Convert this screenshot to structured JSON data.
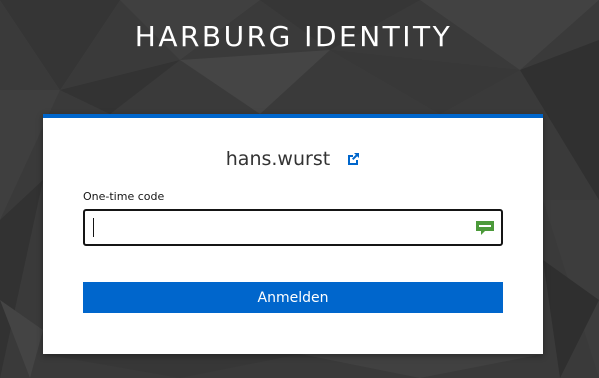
{
  "header": {
    "realm_title": "HARBURG IDENTITY"
  },
  "login": {
    "username": "hans.wurst",
    "switch_user_icon": "external-link-icon",
    "otp_label": "One-time code",
    "otp_value": "",
    "otp_icon": "sms-message-icon",
    "submit_label": "Anmelden"
  },
  "colors": {
    "accent": "#0066cc",
    "background": "#3b3b3b",
    "card": "#ffffff",
    "otp_icon": "#4c9a3a"
  }
}
